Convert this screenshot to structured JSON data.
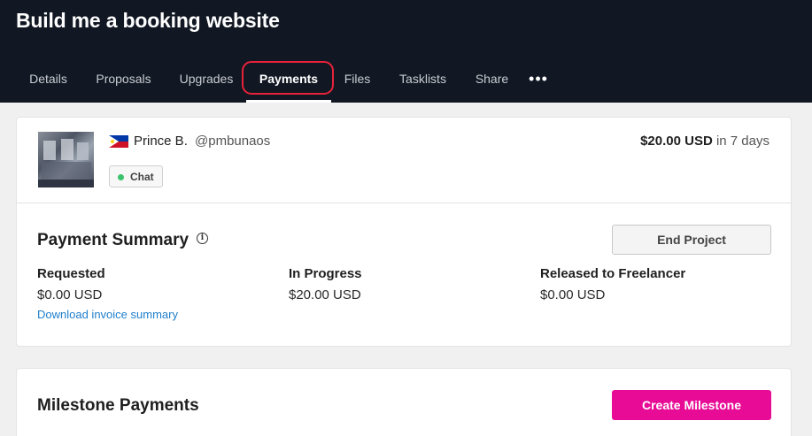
{
  "header": {
    "title": "Build me a booking website",
    "tabs": [
      {
        "label": "Details",
        "active": false
      },
      {
        "label": "Proposals",
        "active": false
      },
      {
        "label": "Upgrades",
        "active": false
      },
      {
        "label": "Payments",
        "active": true
      },
      {
        "label": "Files",
        "active": false
      },
      {
        "label": "Tasklists",
        "active": false
      },
      {
        "label": "Share",
        "active": false
      }
    ],
    "more_icon": "more-horizontal-icon",
    "background_color": "#111723",
    "highlight_color": "#e8223b"
  },
  "freelancer": {
    "name": "Prince B.",
    "handle": "@pmbunaos",
    "flag": "philippines-flag",
    "chat_label": "Chat",
    "online_status_color": "#3bc26c",
    "budget_amount": "$20.00 USD",
    "budget_due": "in 7 days"
  },
  "payment_summary": {
    "title": "Payment Summary",
    "info_icon": "info-icon",
    "end_project_label": "End Project",
    "columns": [
      {
        "label": "Requested",
        "value": "$0.00 USD",
        "link": "Download invoice summary"
      },
      {
        "label": "In Progress",
        "value": "$20.00 USD"
      },
      {
        "label": "Released to Freelancer",
        "value": "$0.00 USD"
      }
    ]
  },
  "milestones": {
    "title": "Milestone Payments",
    "create_label": "Create Milestone",
    "accent_color": "#e80b95"
  }
}
